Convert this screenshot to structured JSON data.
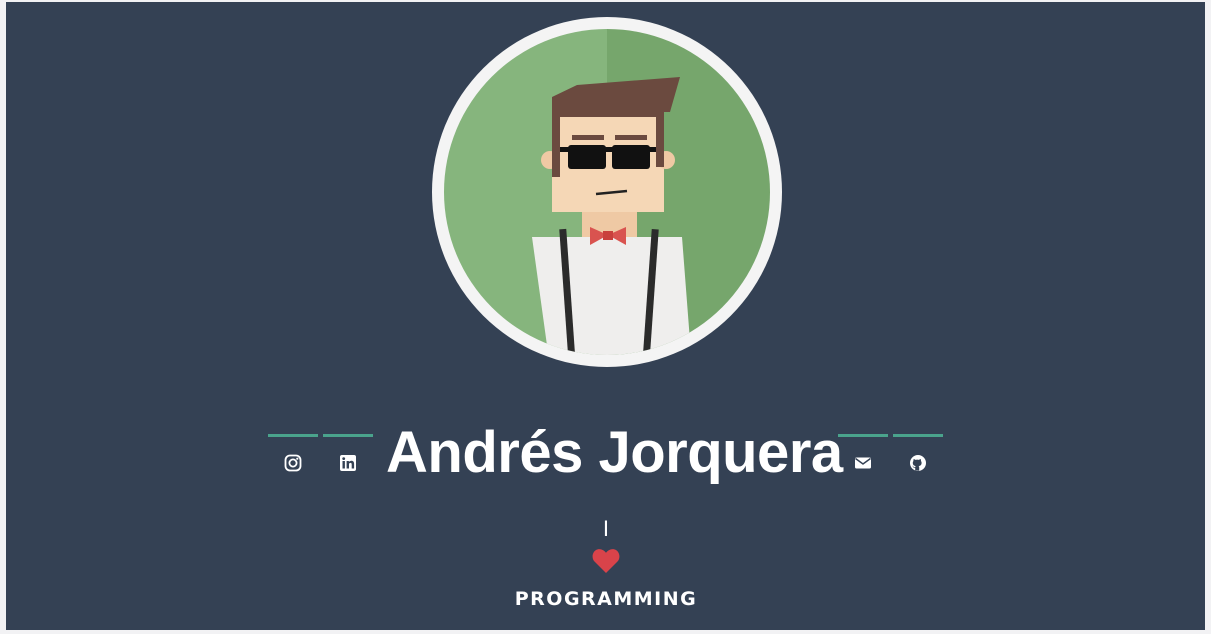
{
  "profile": {
    "name": "Andrés Jorquera",
    "avatar_icon": "cartoon-developer-avatar"
  },
  "social_left": [
    {
      "icon": "instagram-icon"
    },
    {
      "icon": "linkedin-icon"
    }
  ],
  "social_right": [
    {
      "icon": "email-icon"
    },
    {
      "icon": "github-icon"
    }
  ],
  "tagline": {
    "first": "I",
    "heart_icon": "heart-icon",
    "last": "PROGRAMMING"
  },
  "colors": {
    "background": "#344154",
    "accent": "#4aa38c",
    "heart": "#d9434a",
    "avatar_green": "#7aa76d"
  }
}
